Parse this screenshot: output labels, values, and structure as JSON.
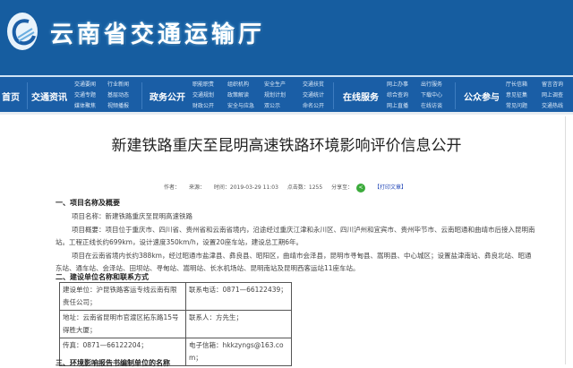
{
  "header": {
    "site_title": "云南省交通运输厅"
  },
  "nav": {
    "home": "首页",
    "groups": [
      {
        "label": "交通资讯",
        "subs": [
          [
            "交通要闻",
            "交通专题",
            "媒体聚焦"
          ],
          [
            "行业新闻",
            "基层动态",
            "视频播报"
          ]
        ]
      },
      {
        "label": "政务公开",
        "subs": [
          [
            "职能职责",
            "交通规划",
            "财政公开"
          ],
          [
            "组织机构",
            "政策解读",
            "安全与应急"
          ],
          [
            "安全生产",
            "规划计划",
            "双公示"
          ],
          [
            "交通扶贫",
            "交通统计",
            "命名公开"
          ]
        ]
      },
      {
        "label": "在线服务",
        "subs": [
          [
            "网上办事",
            "综合查询",
            "网上直播"
          ],
          [
            "出行服务",
            "下载中心",
            "在线访谈"
          ]
        ]
      },
      {
        "label": "公众参与",
        "subs": [
          [
            "厅长信箱",
            "意见征集",
            "常见问题"
          ],
          [
            "留言咨询",
            "网上调查",
            "交通热线"
          ]
        ]
      }
    ]
  },
  "article": {
    "title": "新建铁路重庆至昆明高速铁路环境影响评价信息公开",
    "meta": {
      "author": "作者：",
      "source": "来源：",
      "time": "时间：2019-03-29 11:03",
      "clicks": "点击数：1255",
      "share": "分享至：",
      "print": "【打印文章】"
    },
    "s1": "一、项目名称及概要",
    "lines": [
      "项目名称：新建铁路重庆至昆明高速铁路",
      "项目概要：项目位于重庆市、四川省、贵州省和云南省境内，沿途经过重庆江津和永川区、四川泸州和宜宾市、贵州毕节市、云南昭通和曲靖市后接入昆明南",
      "站。工程正线长约699km，设计速度350km/h，设置20座车站，建设总工期6年。",
      "项目在云南省境内长约388km，经过昭通市盐津县、彝良县、昭阳区，曲靖市会泽县，昆明市寻甸县、嵩明县、中心城区；设置盐津南站、彝良北站、昭通",
      "东站、通车站、会泽站、田坝站、寻甸站、嵩明站、长水机场站、昆明南站及昆明西客运站11座车站。"
    ],
    "s2": "二、建设单位名称和联系方式",
    "table": [
      [
        "建设单位：沪昆铁路客运专线云南有限责任公司；",
        "联系电话：0871—66122439；"
      ],
      [
        "地址：云南省昆明市官渡区拓东路15号得胜大厦；",
        "联系人：方先生；"
      ],
      [
        "传真：0871—66122204；",
        "电子信箱：hkkzyngs@163.com；"
      ]
    ],
    "s3": "三、环境影响报告书编制单位的名称"
  }
}
